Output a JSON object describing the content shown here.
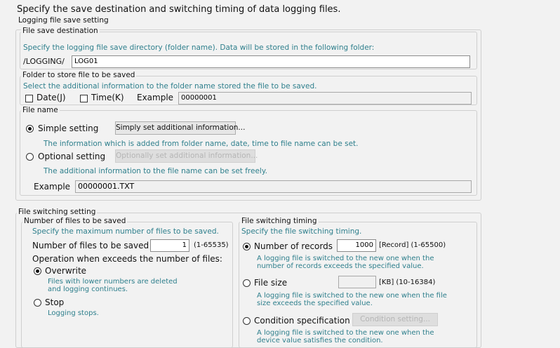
{
  "heading": "Specify the save destination and switching timing of data logging files.",
  "logging": {
    "legend": "Logging file save setting",
    "dest": {
      "legend": "File save destination",
      "hint": "Specify the logging file save directory (folder name). Data will be stored in the following folder:",
      "prefix": "/LOGGING/",
      "value": "LOG01"
    },
    "folder": {
      "legend": "Folder to store file to be saved",
      "hint": "Select the additional information to the folder name stored the file to be saved.",
      "date_label": "Date(J)",
      "time_label": "Time(K)",
      "example_label": "Example",
      "example_value": "00000001"
    },
    "filename": {
      "legend": "File name",
      "simple_label": "Simple setting",
      "simple_button": "Simply set additional information...",
      "simple_hint": "The information which is added from folder name, date, time to file name can be set.",
      "optional_label": "Optional setting",
      "optional_button": "Optionally set additional information...",
      "optional_hint": "The additional information to the file name can be set freely.",
      "example_label": "Example",
      "example_value": "00000001.TXT"
    }
  },
  "switching": {
    "legend": "File switching setting",
    "count": {
      "legend": "Number of files to be saved",
      "hint": "Specify the maximum number of files to be saved.",
      "label": "Number of files to be saved",
      "value": "1",
      "range": "(1-65535)",
      "exceed_label": "Operation when exceeds the number of files:",
      "overwrite_label": "Overwrite",
      "overwrite_hint": "Files with lower numbers are deleted and logging continues.",
      "stop_label": "Stop",
      "stop_hint": "Logging stops."
    },
    "timing": {
      "legend": "File switching timing",
      "hint": "Specify the file switching timing.",
      "records_label": "Number of records",
      "records_value": "1000",
      "records_unit": "[Record] (1-65500)",
      "records_hint": "A logging file is switched to the new one when the number of records exceeds the specified value.",
      "size_label": "File size",
      "size_value": "",
      "size_unit": "[KB] (10-16384)",
      "size_hint": "A logging file is switched to the new one when the file size exceeds the specified value.",
      "cond_label": "Condition specification",
      "cond_button": "Condition setting...",
      "cond_hint": "A logging file is switched to the new one when the device value satisfies the condition."
    }
  }
}
